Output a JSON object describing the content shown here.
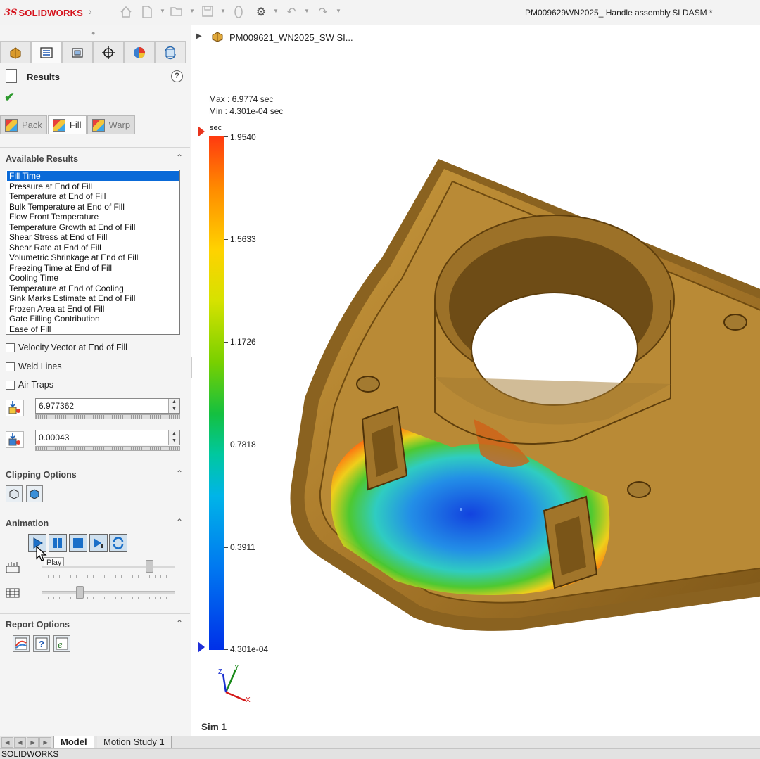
{
  "app": {
    "logo_ds": "3S",
    "logo_name": "SOLIDWORKS",
    "document_title": "PM009629WN2025_ Handle assembly.SLDASM *"
  },
  "toolbar": {
    "icons": [
      "home-icon",
      "new-file-icon",
      "open-folder-icon",
      "save-icon",
      "print-icon",
      "options-gear-icon",
      "undo-icon",
      "redo-icon"
    ]
  },
  "property_manager": {
    "title": "Results",
    "help": "?",
    "ok": "✔",
    "manager_tabs": [
      "feature-manager",
      "property-manager",
      "configuration-manager",
      "dimxpert-manager",
      "display-manager",
      "simulation-manager"
    ],
    "result_tabs": [
      {
        "label": "Pack",
        "active": false
      },
      {
        "label": "Fill",
        "active": true
      },
      {
        "label": "Warp",
        "active": false
      }
    ],
    "available_results": {
      "title": "Available Results",
      "items": [
        "Fill Time",
        "Pressure at End of Fill",
        "Temperature at End of Fill",
        "Bulk Temperature at End of Fill",
        "Flow Front Temperature",
        "Temperature Growth at End of Fill",
        "Shear Stress at End of Fill",
        "Shear Rate at End of Fill",
        "Volumetric Shrinkage at End of Fill",
        "Freezing Time at End of Fill",
        "Cooling Time",
        "Temperature at End of Cooling",
        "Sink Marks Estimate at End of Fill",
        "Frozen Area at End of Fill",
        "Gate Filling Contribution",
        "Ease of Fill"
      ],
      "selected_index": 0
    },
    "checkboxes": [
      {
        "label": "Velocity Vector at End of Fill",
        "checked": false
      },
      {
        "label": "Weld Lines",
        "checked": false
      },
      {
        "label": "Air Traps",
        "checked": false
      }
    ],
    "max_value": "6.977362",
    "min_value": "0.00043",
    "clipping": {
      "title": "Clipping Options"
    },
    "animation": {
      "title": "Animation",
      "tooltip": "Play",
      "speed_level": 0.83,
      "frame_level": 0.27
    },
    "report": {
      "title": "Report Options"
    }
  },
  "graphics": {
    "tree_item": "PM009621_WN2025_SW SI...",
    "max_text": "Max : 6.9774 sec",
    "min_text": "Min : 4.301e-04 sec",
    "legend": {
      "unit": "sec",
      "values": [
        "1.9540",
        "1.5633",
        "1.1726",
        "0.7818",
        "0.3911",
        "4.301e-04"
      ],
      "colors": {
        "top": "#ff3a10",
        "bottom": "#0030e8",
        "marker": "#1f2fd8",
        "marker_top": "#e8331c"
      }
    },
    "triad": {
      "x": "X",
      "y": "Y",
      "z": "Z"
    },
    "study_label": "Sim 1"
  },
  "bottom_tabs": [
    {
      "label": "Model",
      "active": true
    },
    {
      "label": "Motion Study 1",
      "active": false
    }
  ],
  "status_bar": {
    "text": "SOLIDWORKS"
  }
}
